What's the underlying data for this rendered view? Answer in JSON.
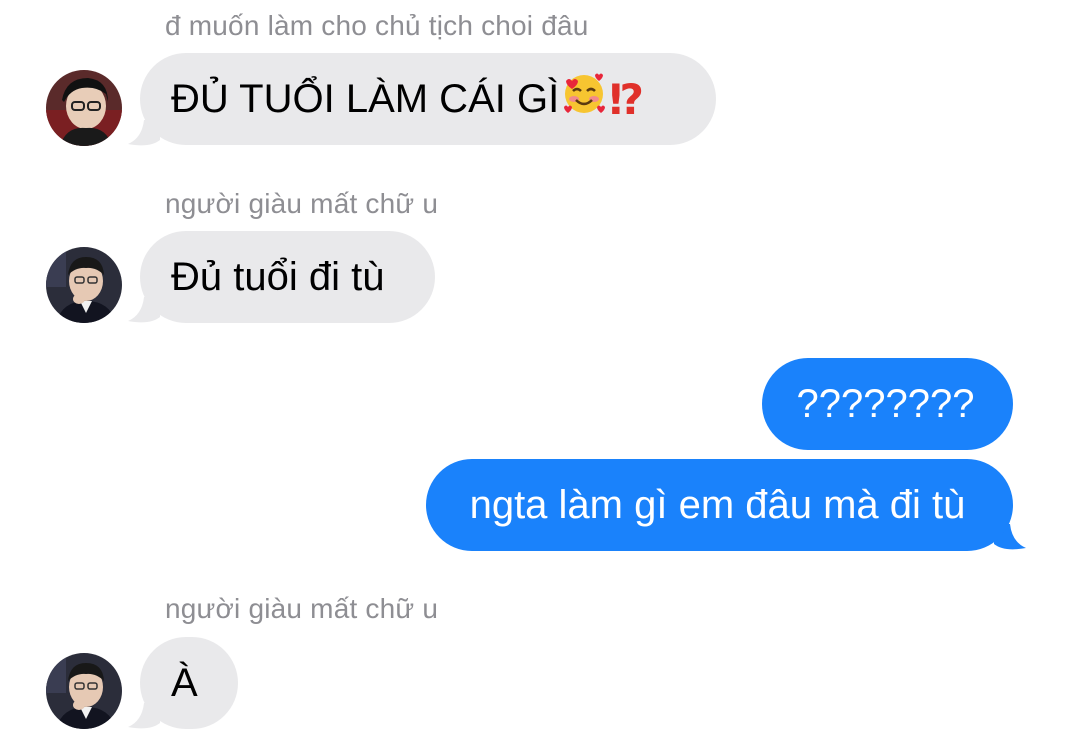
{
  "messages": [
    {
      "sender": "đ muốn làm cho chủ tịch choi đâu",
      "text": "ĐỦ TUỔI LÀM CÁI GÌ",
      "emoji": [
        "smiling-face-with-hearts-icon",
        "exclamation-question-mark-icon"
      ],
      "interrobang": "⁉",
      "direction": "incoming"
    },
    {
      "sender": "người giàu mất chữ u",
      "text": "Đủ tuổi đi tù",
      "direction": "incoming"
    },
    {
      "text": "????????",
      "direction": "outgoing"
    },
    {
      "text": "ngta làm gì em đâu mà đi tù",
      "direction": "outgoing"
    },
    {
      "sender": "người giàu mất chữ u",
      "text": "À",
      "direction": "incoming"
    }
  ],
  "colors": {
    "incoming_bubble": "#e9e9eb",
    "outgoing_bubble": "#1a82fb",
    "sender_name": "#8e8e93"
  }
}
